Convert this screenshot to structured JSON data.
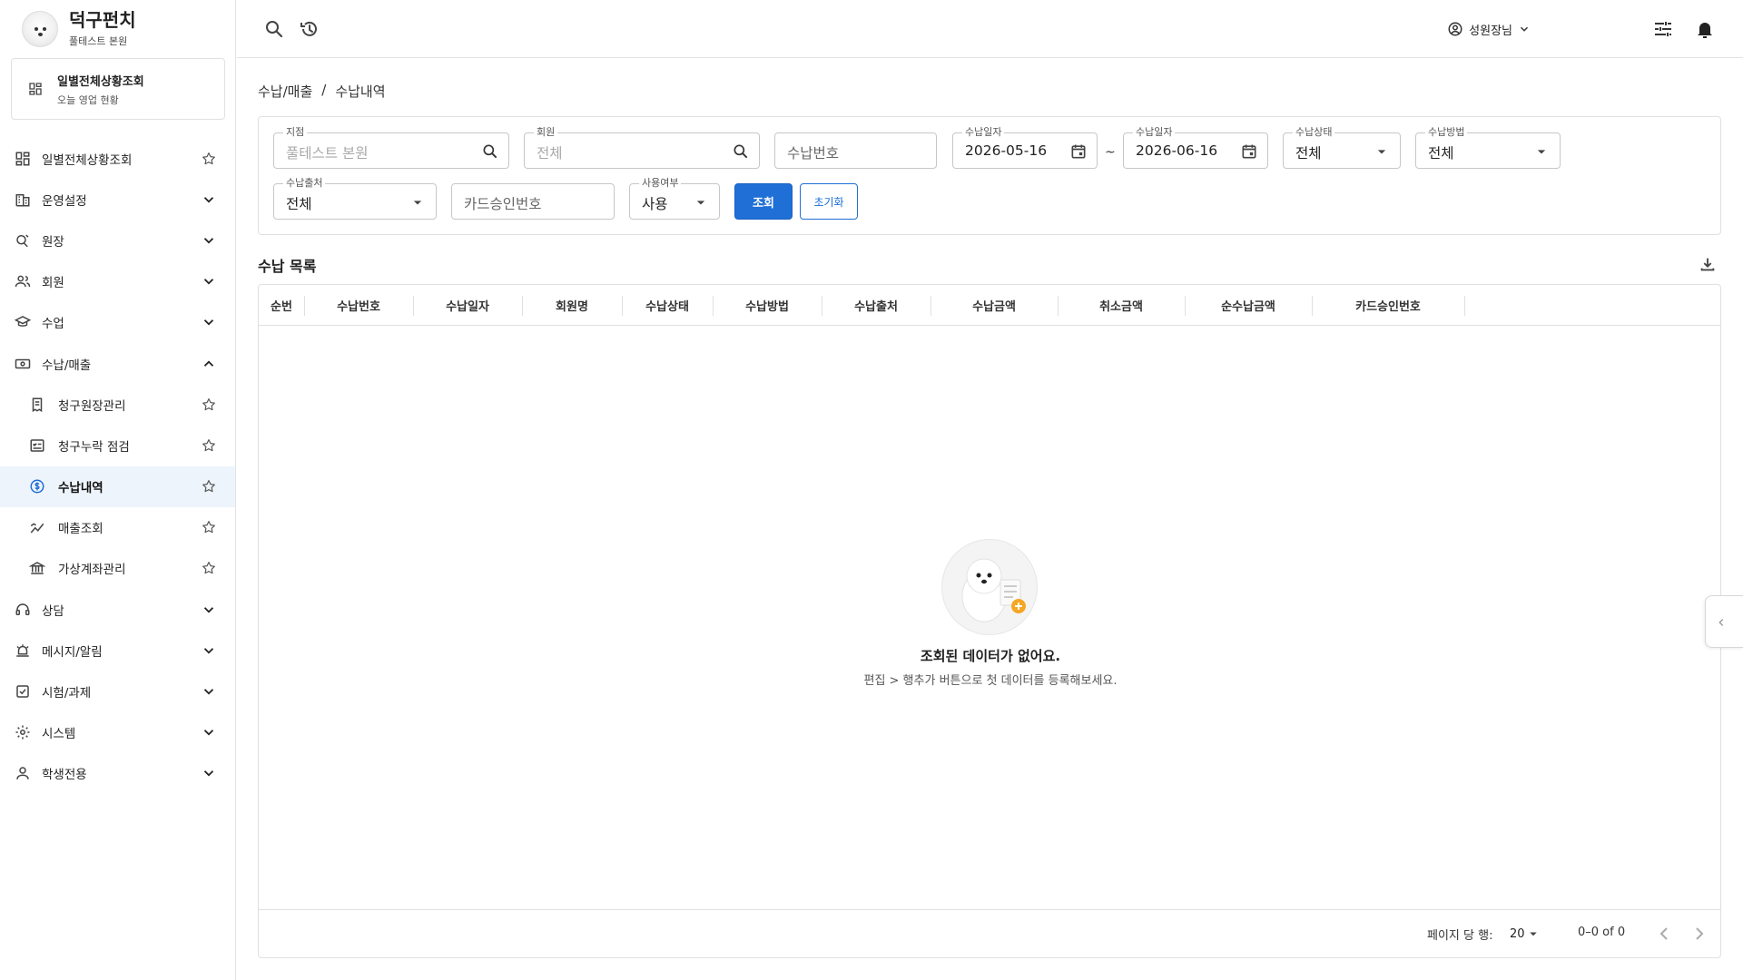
{
  "brand": {
    "title": "덕구펀치",
    "subtitle": "풀테스트 본원"
  },
  "favorite_card": {
    "title": "일별전체상황조회",
    "subtitle": "오늘 영업 현황"
  },
  "sidebar": {
    "items": [
      {
        "label": "일별전체상황조회",
        "icon": "dashboard-icon",
        "tail": "star-icon"
      },
      {
        "label": "운영설정",
        "icon": "building-icon",
        "tail": "chevron-down-icon"
      },
      {
        "label": "원장",
        "icon": "ledger-icon",
        "tail": "chevron-down-icon"
      },
      {
        "label": "회원",
        "icon": "people-icon",
        "tail": "chevron-down-icon"
      },
      {
        "label": "수업",
        "icon": "graduation-cap-icon",
        "tail": "chevron-down-icon"
      },
      {
        "label": "수납/매출",
        "icon": "cash-icon",
        "tail": "chevron-up-icon"
      },
      {
        "label": "청구원장관리",
        "icon": "receipt-icon",
        "tail": "star-icon",
        "sub": true
      },
      {
        "label": "청구누락 점검",
        "icon": "checklist-icon",
        "tail": "star-icon",
        "sub": true
      },
      {
        "label": "수납내역",
        "icon": "dollar-circle-icon",
        "tail": "star-icon",
        "sub": true,
        "active": true
      },
      {
        "label": "매출조회",
        "icon": "chart-line-icon",
        "tail": "star-icon",
        "sub": true
      },
      {
        "label": "가상계좌관리",
        "icon": "bank-icon",
        "tail": "star-icon",
        "sub": true
      },
      {
        "label": "상담",
        "icon": "headset-icon",
        "tail": "chevron-down-icon"
      },
      {
        "label": "메시지/알림",
        "icon": "alarm-icon",
        "tail": "chevron-down-icon"
      },
      {
        "label": "시험/과제",
        "icon": "task-icon",
        "tail": "chevron-down-icon"
      },
      {
        "label": "시스템",
        "icon": "gear-icon",
        "tail": "chevron-down-icon"
      },
      {
        "label": "학생전용",
        "icon": "person-icon",
        "tail": "chevron-down-icon"
      }
    ]
  },
  "topbar": {
    "user_name": "성원장님"
  },
  "breadcrumb": {
    "parent": "수납/매출",
    "separator": "/",
    "current": "수납내역"
  },
  "filters": {
    "branch": {
      "label": "지점",
      "value": "풀테스트 본원"
    },
    "member": {
      "label": "회원",
      "value": "전체"
    },
    "payment_no": {
      "placeholder": "수납번호"
    },
    "date_from": {
      "label": "수납일자",
      "value": "2026-05-16"
    },
    "range_sep": "~",
    "date_to": {
      "label": "수납일자",
      "value": "2026-06-16"
    },
    "status": {
      "label": "수납상태",
      "value": "전체"
    },
    "method": {
      "label": "수납방법",
      "value": "전체"
    },
    "source": {
      "label": "수납출처",
      "value": "전체"
    },
    "card_approval": {
      "placeholder": "카드승인번호"
    },
    "usage": {
      "label": "사용여부",
      "value": "사용"
    },
    "search_button": "조회",
    "reset_button": "초기화"
  },
  "list": {
    "title": "수납 목록",
    "columns": [
      "순번",
      "수납번호",
      "수납일자",
      "회원명",
      "수납상태",
      "수납방법",
      "수납출처",
      "수납금액",
      "취소금액",
      "순수납금액",
      "카드승인번호"
    ],
    "empty_title": "조회된 데이터가 없어요.",
    "empty_desc": "편집 > 행추가 버튼으로 첫 데이터를 등록해보세요."
  },
  "pagination": {
    "rows_per_page_label": "페이지 당 행:",
    "rows_per_page": "20",
    "range": "0–0 of 0"
  },
  "colors": {
    "primary": "#1f6fd6",
    "active_bg": "#eef4fb",
    "border": "#e0e0e0"
  }
}
